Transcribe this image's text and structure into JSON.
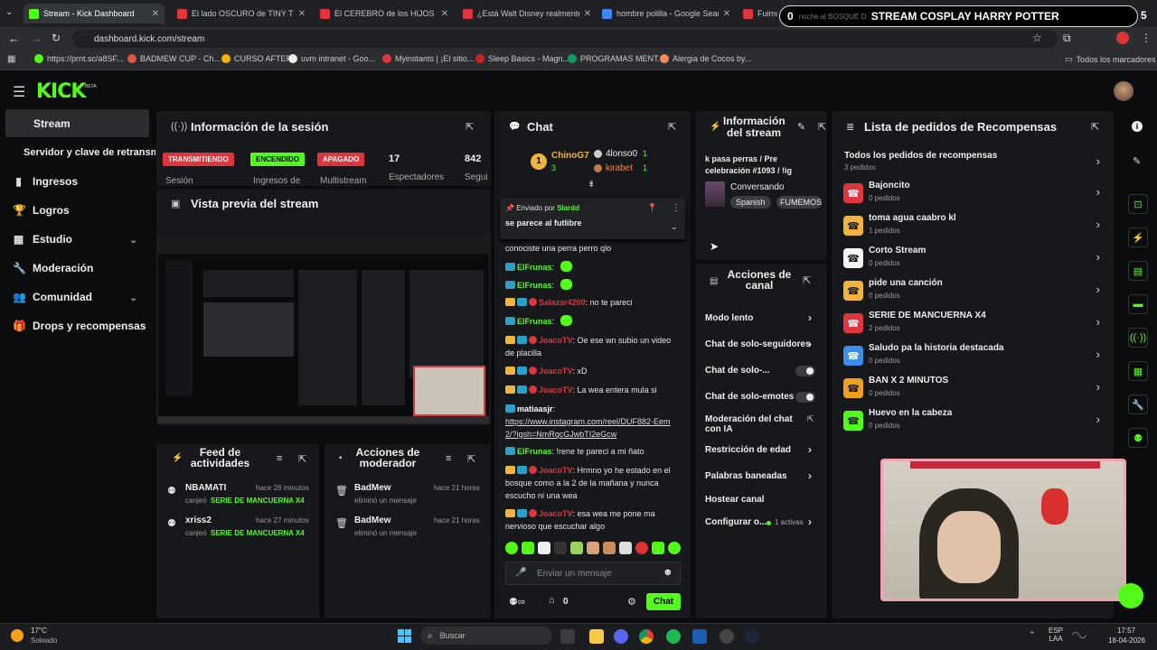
{
  "browser": {
    "tabs": [
      {
        "title": "Stream - Kick Dashboard",
        "color": "#53fc18"
      },
      {
        "title": "El lado OSCURO de TINY TIM -",
        "color": "#e0353d"
      },
      {
        "title": "El CEREBRO de los HIJOS de la",
        "color": "#e0353d"
      },
      {
        "title": "¿Está Walt Disney realmente co",
        "color": "#e0353d"
      },
      {
        "title": "hombre polilla - Google Search",
        "color": "#4285f4"
      },
      {
        "title": "Fuimos",
        "color": "#e0353d"
      }
    ],
    "url": "dashboard.kick.com/stream",
    "bookmarks": [
      "https://prnt.sc/a8SF...",
      "BADMEW CUP - Ch...",
      "CURSO AFTER",
      "uvm intranet - Goo...",
      "Myinstants | ¡El sitio...",
      "Sleep Basics - Magn...",
      "PROGRAMAS MENT...",
      "Alergia de Cocos by..."
    ],
    "all_bookmarks": "Todos los marcadores",
    "ext_banner": "STREAM COSPLAY HARRY POTTER",
    "ext_left": "0",
    "ext_sub": "noche al BOSQUE D",
    "ext_right": "5"
  },
  "brand": {
    "logo": "KICK",
    "beta": "BETA"
  },
  "sidebar": {
    "items": [
      {
        "label": "Stream",
        "icon": "video-icon"
      },
      {
        "label": "Servidor y clave de retransmisión"
      },
      {
        "label": "Ingresos",
        "icon": "chart-icon"
      },
      {
        "label": "Logros",
        "icon": "trophy-icon"
      },
      {
        "label": "Estudio",
        "icon": "grid-icon"
      },
      {
        "label": "Moderación",
        "icon": "wrench-icon"
      },
      {
        "label": "Comunidad",
        "icon": "users-icon"
      },
      {
        "label": "Drops y recompensas",
        "icon": "gift-icon"
      }
    ]
  },
  "session": {
    "title": "Información de la sesión",
    "badges": [
      {
        "text": "TRANSMITIENDO",
        "label": "Sesión"
      },
      {
        "text": "ENCENDIDO",
        "label": "Ingresos de"
      },
      {
        "text": "APAGADO",
        "label": "Multistream"
      }
    ],
    "stats": [
      {
        "value": "17",
        "label": "Espectadores"
      },
      {
        "value": "842",
        "label": "Segui"
      }
    ]
  },
  "preview": {
    "title": "Vista previa del stream"
  },
  "feed": {
    "title": "Feed de actividades",
    "rows": [
      {
        "user": "NBAMATI",
        "time": "hace 26 minutos",
        "action": "canjeó",
        "reward": "SERIE DE MANCUERNA X4"
      },
      {
        "user": "xriss2",
        "time": "hace 27 minutos",
        "action": "canjeó",
        "reward": "SERIE DE MANCUERNA X4"
      }
    ]
  },
  "modactions": {
    "title": "Acciones de moderador",
    "rows": [
      {
        "user": "BadMew",
        "time": "hace 21 horas",
        "action": "eliminó un mensaje"
      },
      {
        "user": "BadMew",
        "time": "hace 21 horas",
        "action": "eliminó un mensaje"
      }
    ]
  },
  "chat": {
    "title": "Chat",
    "top": [
      {
        "rank": "1",
        "name": "ChinoG7",
        "val": "3"
      },
      {
        "name": "4lonso0",
        "val": "1"
      },
      {
        "name": "kirabet",
        "val": "1"
      }
    ],
    "pinned": {
      "by_label": "Enviado por",
      "by": "Slardd",
      "text": "se parece al futlibre"
    },
    "messages": [
      {
        "user": "",
        "text": "conociste una perra perro qlo",
        "color": "w"
      },
      {
        "user": "ElFrunas",
        "text": "",
        "color": "g",
        "emoji": true
      },
      {
        "user": "ElFrunas",
        "text": "",
        "color": "g",
        "emoji": true
      },
      {
        "user": "Salazar4200",
        "text": "no te pareci",
        "color": "r"
      },
      {
        "user": "ElFrunas",
        "text": "",
        "color": "g",
        "emoji": true
      },
      {
        "user": "JoacoTV",
        "text": "Oe ese wn subio un video de placilla",
        "color": "r"
      },
      {
        "user": "JoacoTV",
        "text": "xD",
        "color": "r"
      },
      {
        "user": "JoacoTV",
        "text": "La wea entera mula si",
        "color": "r"
      },
      {
        "user": "matiaasjr",
        "text": "https://www.instagram.com/reel/DUF882-Eem2/?igsh=NmRqcGJwbTI2eGcw",
        "color": "w"
      },
      {
        "user": "ElFrunas",
        "text": "!rene te pareci a mi ñato",
        "color": "g"
      },
      {
        "user": "JoacoTV",
        "text": "Hrmno yo he estado en el bosque como a la 2 de la mañana y nunca escucho ni una wea",
        "color": "r"
      },
      {
        "user": "JoacoTV",
        "text": "esa wea me pone ma nervioso que escuchar algo",
        "color": "r"
      }
    ],
    "input_placeholder": "Enviar un mensaje",
    "count": "0",
    "send": "Chat"
  },
  "streaminfo": {
    "title": "Información del stream",
    "text": "k pasa perras / Pre celebración #1093 / !ig",
    "category": "Conversando",
    "tags": [
      "Spanish",
      "FUMEMOS"
    ]
  },
  "channel": {
    "title": "Acciones de canal",
    "rows": [
      {
        "label": "Modo lento",
        "type": "chev"
      },
      {
        "label": "Chat de solo-seguidores",
        "type": "chev"
      },
      {
        "label": "Chat de solo-...",
        "type": "toggle"
      },
      {
        "label": "Chat de solo-emotes",
        "type": "toggle"
      },
      {
        "label": "Moderación del chat con IA",
        "type": "ext"
      },
      {
        "label": "Restricción de edad",
        "type": "chev"
      },
      {
        "label": "Palabras baneadas",
        "type": "chev"
      },
      {
        "label": "Hostear canal",
        "type": "none"
      },
      {
        "label": "Configurar o...",
        "type": "active",
        "extra": "1 activas"
      }
    ]
  },
  "rewards": {
    "title": "Lista de pedidos de Recompensas",
    "all": "Todos los pedidos de recompensas",
    "all_count": "3 pedidos",
    "items": [
      {
        "name": "Bajoncito",
        "count": "0 pedidos",
        "color": "#e0353d"
      },
      {
        "name": "toma agua caabro kl",
        "count": "1 pedidos",
        "color": "#f0b43c"
      },
      {
        "name": "Corto Stream",
        "count": "0 pedidos",
        "color": "#f5f5f5"
      },
      {
        "name": "pide una canción",
        "count": "0 pedidos",
        "color": "#f0b43c"
      },
      {
        "name": "SERIE DE MANCUERNA X4",
        "count": "2 pedidos",
        "color": "#e0353d"
      },
      {
        "name": "Saludo pa la historia destacada",
        "count": "0 pedidos",
        "color": "#3b8eea"
      },
      {
        "name": "BAN X 2 MINUTOS",
        "count": "0 pedidos",
        "color": "#f0a020"
      },
      {
        "name": "Huevo en la cabeza",
        "count": "0 pedidos",
        "color": "#53fc18"
      }
    ]
  },
  "taskbar": {
    "weather_temp": "17°C",
    "weather_desc": "Soleado",
    "search": "Buscar",
    "lang": "ESP",
    "region": "LAA",
    "time": "17:57",
    "date": "18-04-2026"
  }
}
